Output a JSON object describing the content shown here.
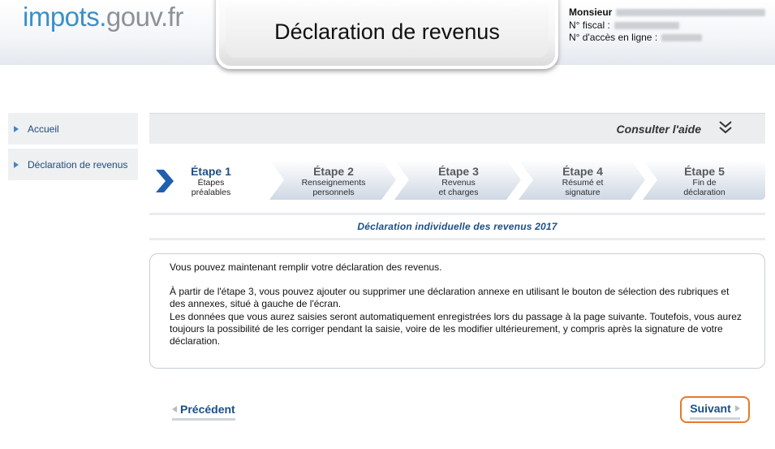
{
  "brand": {
    "part1": "impots.",
    "part2": "gouv.fr"
  },
  "page_title": "Déclaration de revenus",
  "user": {
    "title": "Monsieur",
    "fiscal_label": "N° fiscal :",
    "access_label": "N° d'accès en ligne :"
  },
  "sidebar": {
    "items": [
      {
        "label": "Accueil"
      },
      {
        "label": "Déclaration de revenus"
      }
    ]
  },
  "help": {
    "label": "Consulter l'aide",
    "icon": "double-chevron-down-icon"
  },
  "steps": [
    {
      "title": "Étape 1",
      "line1": "Étapes",
      "line2": "préalables",
      "state": "current"
    },
    {
      "title": "Étape 2",
      "line1": "Renseignements",
      "line2": "personnels",
      "state": "upcoming"
    },
    {
      "title": "Étape 3",
      "line1": "Revenus",
      "line2": "et charges",
      "state": "upcoming"
    },
    {
      "title": "Étape 4",
      "line1": "Résumé et",
      "line2": "signature",
      "state": "upcoming"
    },
    {
      "title": "Étape 5",
      "line1": "Fin de",
      "line2": "déclaration",
      "state": "upcoming"
    }
  ],
  "section_title": "Déclaration individuelle des revenus 2017",
  "info": {
    "p1": "Vous pouvez maintenant remplir votre déclaration des revenus.",
    "p2": "À partir de l'étape 3, vous pouvez ajouter ou supprimer une déclaration annexe en utilisant le bouton de sélection des rubriques et des annexes, situé à gauche de l'écran.",
    "p3": "Les données que vous aurez saisies seront automatiquement enregistrées lors du passage à la page suivante. Toutefois, vous aurez toujours la possibilité de les corriger pendant la saisie, voire de les modifier ultérieurement, y compris après la signature de votre déclaration."
  },
  "nav": {
    "prev_label": "Précédent",
    "next_label": "Suivant"
  },
  "colors": {
    "accent_blue": "#1c4f86",
    "focus_orange": "#e9782a",
    "logo_blue": "#3a90c8"
  }
}
